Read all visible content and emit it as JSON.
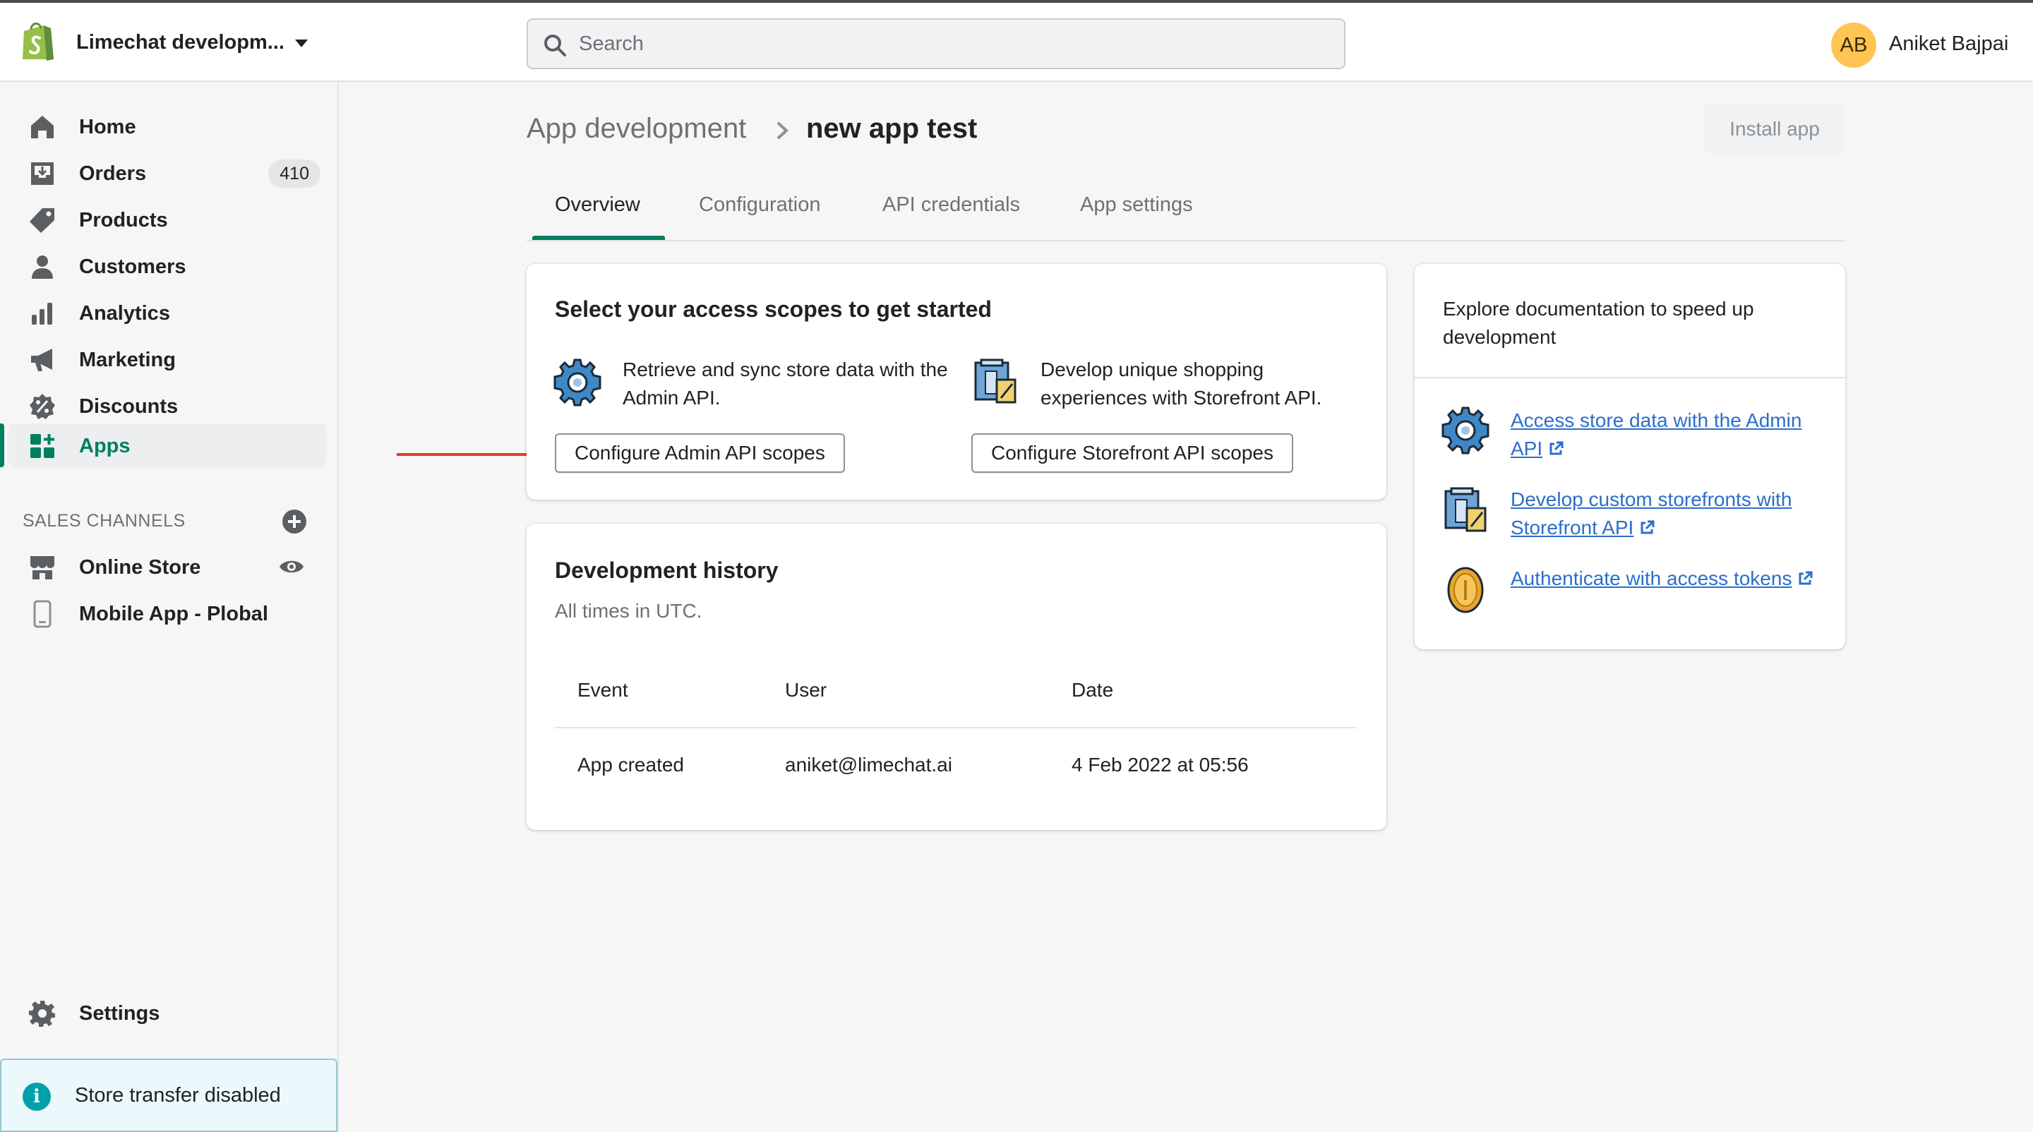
{
  "topbar": {
    "store_name": "Limechat developm...",
    "search_placeholder": "Search",
    "user_initials": "AB",
    "user_name": "Aniket Bajpai"
  },
  "sidebar": {
    "items": [
      {
        "label": "Home",
        "icon": "home-icon"
      },
      {
        "label": "Orders",
        "icon": "orders-icon",
        "badge": "410"
      },
      {
        "label": "Products",
        "icon": "tag-icon"
      },
      {
        "label": "Customers",
        "icon": "person-icon"
      },
      {
        "label": "Analytics",
        "icon": "bar-chart-icon"
      },
      {
        "label": "Marketing",
        "icon": "megaphone-icon"
      },
      {
        "label": "Discounts",
        "icon": "discount-icon"
      },
      {
        "label": "Apps",
        "icon": "apps-icon",
        "active": true
      }
    ],
    "sales_channels_title": "SALES CHANNELS",
    "channels": [
      {
        "label": "Online Store",
        "icon": "store-icon"
      },
      {
        "label": "Mobile App - Plobal",
        "icon": "mobile-icon"
      }
    ],
    "settings_label": "Settings",
    "store_transfer_label": "Store transfer disabled"
  },
  "main": {
    "breadcrumb_parent": "App development",
    "page_title": "new app test",
    "install_button": "Install app",
    "tabs": [
      {
        "label": "Overview",
        "active": true
      },
      {
        "label": "Configuration"
      },
      {
        "label": "API credentials"
      },
      {
        "label": "App settings"
      }
    ],
    "scopes_card": {
      "title": "Select your access scopes to get started",
      "admin_text": "Retrieve and sync store data with the Admin API.",
      "admin_button": "Configure Admin API scopes",
      "storefront_text": "Develop unique shopping experiences with Storefront API.",
      "storefront_button": "Configure Storefront API scopes"
    },
    "history_card": {
      "title": "Development history",
      "subtitle": "All times in UTC.",
      "columns": [
        "Event",
        "User",
        "Date"
      ],
      "rows": [
        [
          "App created",
          "aniket@limechat.ai",
          "4 Feb 2022 at 05:56"
        ]
      ]
    },
    "docs_card": {
      "heading": "Explore documentation to speed up development",
      "links": [
        {
          "label": "Access store data with the Admin API",
          "icon": "gear-icon"
        },
        {
          "label": "Develop custom storefronts with Storefront API",
          "icon": "storefront-icon"
        },
        {
          "label": "Authenticate with access tokens",
          "icon": "coin-icon"
        }
      ]
    }
  },
  "colors": {
    "accent_green": "#008060",
    "link_blue": "#2c6ecb",
    "annotation_arrow": "#e03e2d",
    "avatar_bg": "#ffc453"
  }
}
